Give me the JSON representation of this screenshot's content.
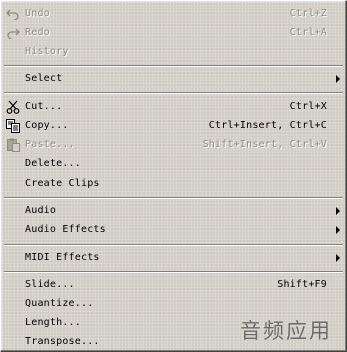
{
  "menu": {
    "undo": {
      "label": "Undo",
      "shortcut": "Ctrl+Z",
      "icon": "undo-icon"
    },
    "redo": {
      "label": "Redo",
      "shortcut": "Ctrl+A",
      "icon": "redo-icon"
    },
    "history": {
      "label": "History"
    },
    "select": {
      "label": "Select"
    },
    "cut": {
      "label": "Cut...",
      "shortcut": "Ctrl+X",
      "icon": "scissors-icon"
    },
    "copy": {
      "label": "Copy...",
      "shortcut": "Ctrl+Insert, Ctrl+C",
      "icon": "copy-icon"
    },
    "paste": {
      "label": "Paste...",
      "shortcut": "Shift+Insert, Ctrl+V",
      "icon": "paste-icon"
    },
    "delete": {
      "label": "Delete..."
    },
    "create_clips": {
      "label": "Create Clips"
    },
    "audio": {
      "label": "Audio"
    },
    "audio_effects": {
      "label": "Audio Effects"
    },
    "midi_effects": {
      "label": "MIDI Effects"
    },
    "slide": {
      "label": "Slide...",
      "shortcut": "Shift+F9"
    },
    "quantize": {
      "label": "Quantize..."
    },
    "length": {
      "label": "Length..."
    },
    "transpose": {
      "label": "Transpose..."
    }
  },
  "watermark": "音频应用",
  "colors": {
    "background": "#d4d0c8",
    "disabled_text": "#8e8b83",
    "text": "#000000"
  }
}
